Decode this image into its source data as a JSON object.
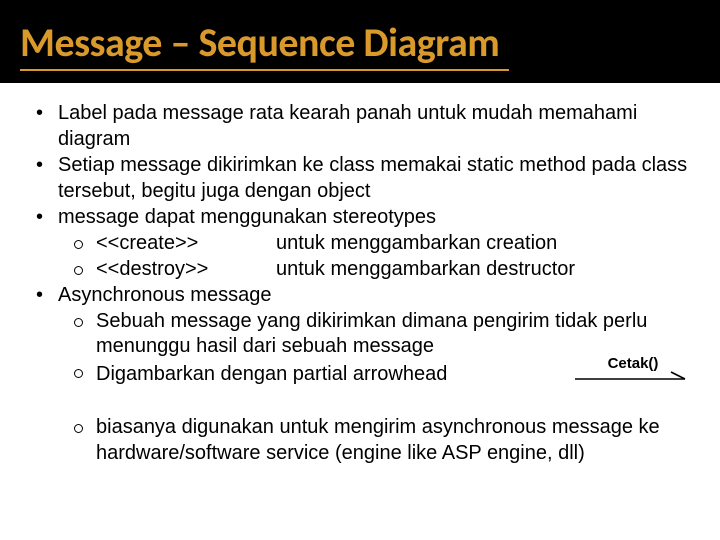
{
  "title": "Message – Sequence Diagram",
  "bullets": {
    "b1": "Label pada message rata kearah panah untuk mudah memahami diagram",
    "b2": "Setiap message dikirimkan ke class memakai static method pada class tersebut, begitu juga dengan object",
    "b3": "message dapat menggunakan stereotypes",
    "b3a_label": "<<create>>",
    "b3a_desc": "untuk menggambarkan creation",
    "b3b_label": "<<destroy>>",
    "b3b_desc": "untuk menggambarkan destructor",
    "b4": "Asynchronous message",
    "b4a": "Sebuah message yang dikirimkan dimana pengirim tidak perlu menunggu hasil dari sebuah message",
    "b4b": "Digambarkan dengan partial arrowhead",
    "b4c": "biasanya digunakan untuk mengirim asynchronous message ke hardware/software service (engine like ASP engine, dll)"
  },
  "diagram": {
    "arrow_label": "Cetak()"
  }
}
